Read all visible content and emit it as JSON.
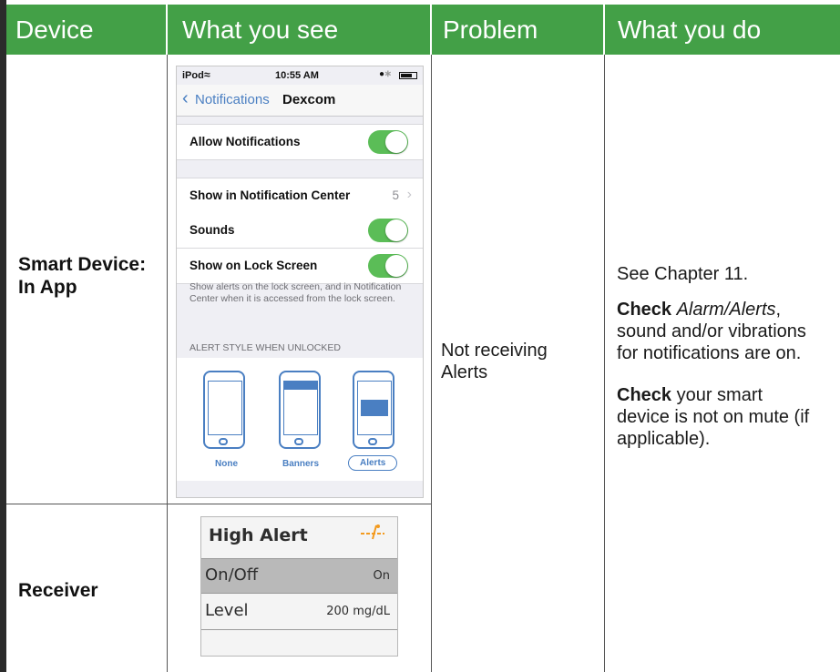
{
  "headers": [
    "Device",
    "What you see",
    "Problem",
    "What you do"
  ],
  "rows": [
    {
      "device": "Smart Device:\nIn App"
    },
    {
      "device": "Receiver"
    }
  ],
  "problem": "Not receiving\nAlerts",
  "actions": {
    "p1": "See Chapter 11.",
    "p2_bold": "Check",
    "p2_italic": "Alarm/Alerts",
    "p2_rest": ",\nsound and/or vibrations\nfor notifications are on.",
    "p3_bold": "Check",
    "p3_rest": " your smart\ndevice is not on mute (if\napplicable)."
  },
  "phone": {
    "status_left": "iPod",
    "time": "10:55 AM",
    "back_label": "Notifications",
    "nav_title": "Dexcom",
    "allow": "Allow Notifications",
    "show_center": "Show in Notification Center",
    "show_center_value": "5",
    "sounds": "Sounds",
    "lock_screen": "Show on Lock Screen",
    "description": "Show alerts on the lock screen, and in Notification Center when it is accessed from the lock screen.",
    "section": "ALERT STYLE WHEN UNLOCKED",
    "styles": [
      "None",
      "Banners",
      "Alerts"
    ],
    "accent": "#4a7fc2",
    "toggle_color": "#5bbd57"
  },
  "receiver": {
    "title": "High Alert",
    "row1_label": "On/Off",
    "row1_value": "On",
    "row2_label": "Level",
    "row2_value": "200 mg/dL",
    "icon_color": "#f39a1e"
  },
  "colors": {
    "header": "#43a047"
  }
}
